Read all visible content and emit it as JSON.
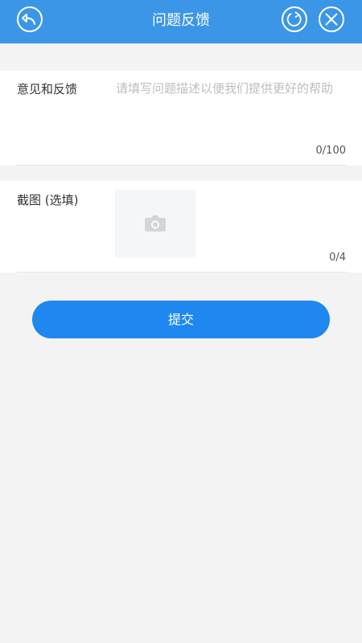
{
  "header": {
    "title": "问题反馈",
    "back_icon": "reply-arrow-icon",
    "refresh_icon": "refresh-icon",
    "close_icon": "close-x-icon"
  },
  "feedback": {
    "label": "意见和反馈",
    "value": "",
    "placeholder": "请填写问题描述以便我们提供更好的帮助",
    "counter": "0/100"
  },
  "screenshot": {
    "label": "截图 (选填)",
    "upload_icon": "camera-icon",
    "counter": "0/4"
  },
  "submit": {
    "label": "提交"
  },
  "colors": {
    "header_bg": "#3b96e8",
    "button_bg": "#1e88f0",
    "page_bg": "#f3f3f3"
  }
}
